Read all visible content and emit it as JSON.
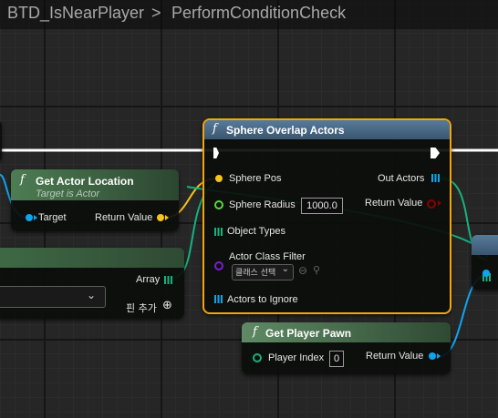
{
  "breadcrumb": {
    "blueprint": "BTD_IsNearPlayer",
    "separator": ">",
    "function": "PerformConditionCheck"
  },
  "nodes": {
    "sphere_overlap": {
      "title": "Sphere Overlap Actors",
      "icon": "f",
      "pins": {
        "sphere_pos": "Sphere Pos",
        "sphere_radius": "Sphere Radius",
        "sphere_radius_value": "1000.0",
        "object_types": "Object Types",
        "actor_class_filter": "Actor Class Filter",
        "class_select": "클래스 선택",
        "actors_to_ignore": "Actors to Ignore",
        "out_actors": "Out Actors",
        "return_value": "Return Value"
      }
    },
    "get_actor_location": {
      "title": "Get Actor Location",
      "subtitle": "Target is Actor",
      "icon": "f",
      "pins": {
        "target": "Target",
        "return_value": "Return Value"
      }
    },
    "make_array": {
      "array": "Array",
      "add_pin": "핀 추가",
      "add_pin_icon": "⊕"
    },
    "get_player_pawn": {
      "title": "Get Player Pawn",
      "icon": "f",
      "pins": {
        "player_index": "Player Index",
        "player_index_value": "0",
        "return_value": "Return Value"
      }
    }
  },
  "colors": {
    "exec": "#ffffff",
    "vector": "#f7c418",
    "float": "#57d93a",
    "object": "#0fa4ee",
    "class": "#7e1ad6",
    "bool": "#8a0000",
    "enum_array": "#17b17e",
    "selection": "#f2a412",
    "function_header": "#4a6a88",
    "pure_header": "#3f6a45"
  }
}
